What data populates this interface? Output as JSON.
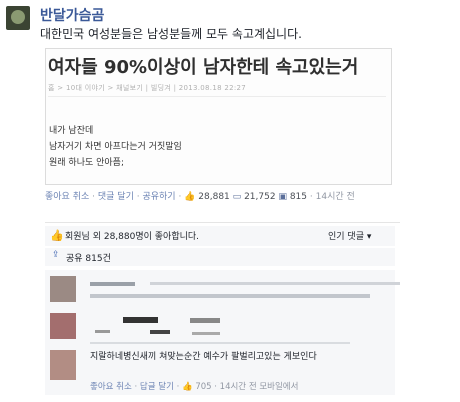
{
  "post": {
    "author": "반달가슴곰",
    "text": "대한민국 여성분들은 남성분들께 모두 속고계십니다."
  },
  "card": {
    "headline": "여자들 90%이상이 남자한테 속고있는거",
    "meta": "홈 > 10대 이야기 > 채널보기 | 빌딩겨 | 2013.08.18 22:27",
    "body": [
      "내가 남잔데",
      "남자거기 차면 아프다는거 거짓말임",
      "원래 하나도 안아픔;"
    ]
  },
  "actions": {
    "unlike": "좋아요 취소",
    "comment": "댓글 달기",
    "share": "공유하기",
    "likes_count": "28,881",
    "comments_count": "21,752",
    "shares_count": "815",
    "time": "14시간 전"
  },
  "likes_summary": {
    "text": "회원님 외 28,880명이 좋아합니다.",
    "sort_label": "인기 댓글 ▾"
  },
  "shares_summary": {
    "text": "공유 815건"
  },
  "comment": {
    "text": "지랄하네병신새끼 쳐맞는순간 예수가 팔벌리고있는 게보인다",
    "unlike": "좋아요 취소",
    "reply": "답글 달기",
    "likes": "705",
    "time": "14시간 전 모바일에서"
  },
  "colors": {
    "link": "#6d84b4",
    "brand": "#3b5998",
    "bg_light": "#f6f7f9"
  },
  "icons": [
    "thumbs-up-icon",
    "comment-icon",
    "share-icon",
    "like-summary-icon"
  ]
}
